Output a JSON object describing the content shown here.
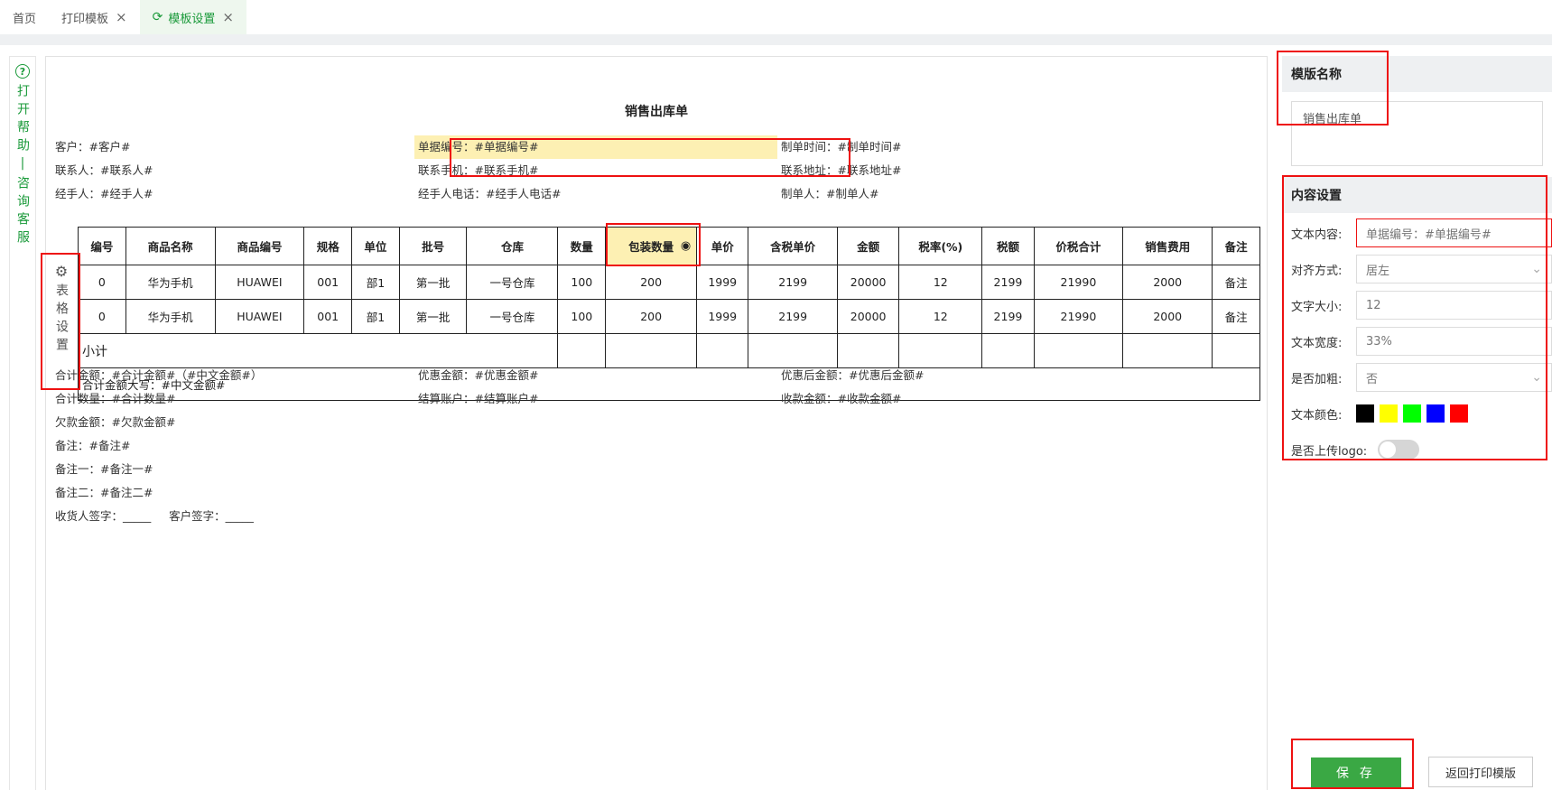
{
  "tabs": [
    {
      "label": "首页",
      "closable": false,
      "active": false
    },
    {
      "label": "打印模板",
      "closable": true,
      "active": false
    },
    {
      "label": "模板设置",
      "closable": true,
      "active": true
    }
  ],
  "help": {
    "text": "打开帮助|咨询客服"
  },
  "document": {
    "title": "销售出库单",
    "header_fields": [
      "客户：#客户#",
      "单据编号：#单据编号#",
      "制单时间：#制单时间#",
      "联系人：#联系人#",
      "联系手机：#联系手机#",
      "联系地址：#联系地址#",
      "经手人：#经手人#",
      "经手人电话：#经手人电话#",
      "制单人：#制单人#"
    ],
    "table_settings_label": "表格设置",
    "table": {
      "columns": [
        "编号",
        "商品名称",
        "商品编号",
        "规格",
        "单位",
        "批号",
        "仓库",
        "数量",
        "包装数量",
        "单价",
        "含税单价",
        "金额",
        "税率(%)",
        "税额",
        "价税合计",
        "销售费用",
        "备注"
      ],
      "rows": [
        [
          "0",
          "华为手机",
          "HUAWEI",
          "001",
          "部1",
          "第一批",
          "一号仓库",
          "100",
          "200",
          "1999",
          "2199",
          "20000",
          "12",
          "2199",
          "21990",
          "2000",
          "备注"
        ],
        [
          "0",
          "华为手机",
          "HUAWEI",
          "001",
          "部1",
          "第一批",
          "一号仓库",
          "100",
          "200",
          "1999",
          "2199",
          "20000",
          "12",
          "2199",
          "21990",
          "2000",
          "备注"
        ]
      ],
      "subtotal_label": "小计",
      "total_upper": "合计金额大写：#中文金额#"
    },
    "footer_fields": [
      "合计金额：#合计金额#（#中文金额#）",
      "优惠金额：#优惠金额#",
      "优惠后金额：#优惠后金额#",
      "合计数量：#合计数量#",
      "结算账户：#结算账户#",
      "收款金额：#收款金额#",
      "欠款金额：#欠款金额#",
      "备注：#备注#",
      "备注一：#备注一#",
      "备注二：#备注二#"
    ],
    "signatures": "收货人签字：_____     客户签字：_____"
  },
  "panel": {
    "template_name_header": "模版名称",
    "template_name_value": "销售出库单",
    "content_header": "内容设置",
    "labels": {
      "text_content": "文本内容:",
      "align": "对齐方式:",
      "font_size": "文字大小:",
      "text_width": "文本宽度:",
      "bold": "是否加粗:",
      "color": "文本颜色:",
      "logo": "是否上传logo:"
    },
    "values": {
      "text_content": "单据编号：#单据编号#",
      "align": "居左",
      "font_size": "12",
      "text_width": "33%",
      "bold": "否"
    },
    "colors": [
      "#000000",
      "#ffff00",
      "#00ff00",
      "#0000ff",
      "#ff0000"
    ],
    "logo_enabled": false
  },
  "buttons": {
    "save": "保 存",
    "back": "返回打印模版"
  }
}
